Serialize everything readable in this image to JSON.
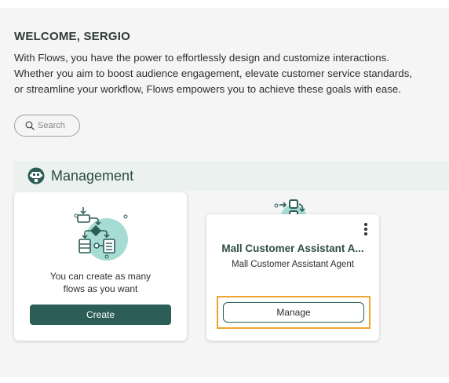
{
  "welcome": {
    "title": "WELCOME, SERGIO",
    "lines": [
      "With Flows, you have the power to effortlessly design and customize interactions.",
      "Whether you aim to boost audience engagement, elevate customer service standards,",
      "or streamline your workflow, Flows empowers you to achieve these goals with ease."
    ]
  },
  "search": {
    "placeholder": "Search",
    "icon": "search-icon"
  },
  "section": {
    "title": "Management",
    "icon": "robot-icon"
  },
  "create_card": {
    "icon": "flow-diagram-icon",
    "text_lines": [
      "You can create as many",
      "flows as you want"
    ],
    "button_label": "Create"
  },
  "agent_card": {
    "icon": "flow-nodes-icon",
    "title": "Mall Customer Assistant A...",
    "subtitle": "Mall Customer Assistant Agent",
    "menu_icon": "kebab-menu-icon",
    "button_label": "Manage"
  },
  "colors": {
    "primary": "#2d5d57",
    "background": "#f4f5f4",
    "section_bg": "#eaf1ee",
    "accent_teal": "#a7dcd5",
    "focus_ring": "#f0a533"
  }
}
